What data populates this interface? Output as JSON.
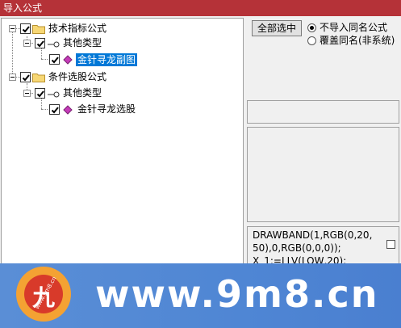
{
  "window": {
    "title": "导入公式"
  },
  "tree": {
    "nodes": [
      {
        "label": "技术指标公式",
        "checked": true,
        "level": 0,
        "icon": "folder-icon"
      },
      {
        "label": "其他类型",
        "checked": true,
        "level": 1,
        "icon": "key-icon"
      },
      {
        "label": "金针寻龙副图",
        "checked": true,
        "level": 2,
        "icon": "formula-gem-icon",
        "selected": true
      },
      {
        "label": "条件选股公式",
        "checked": true,
        "level": 0,
        "icon": "folder-icon"
      },
      {
        "label": "其他类型",
        "checked": true,
        "level": 1,
        "icon": "key-icon"
      },
      {
        "label": "金针寻龙选股",
        "checked": true,
        "level": 2,
        "icon": "formula-gem-icon"
      }
    ]
  },
  "controls": {
    "select_all_label": "全部选中",
    "radio_options": [
      {
        "label": "不导入同名公式",
        "selected": true
      },
      {
        "label": "覆盖同名(非系统)",
        "selected": false
      }
    ]
  },
  "code_preview": {
    "text": "DRAWBAND(1,RGB(0,20,50),0,RGB(0,0,0));\nX_1:=LLV(LOW,20);"
  },
  "banner": {
    "logo_glyph": "九",
    "logo_small_text": "www.9m8.cn",
    "site_text": "www.9m8.cn"
  },
  "colors": {
    "titlebar": "#b53238",
    "selection": "#0078d7",
    "banner": "#4f86d4"
  }
}
